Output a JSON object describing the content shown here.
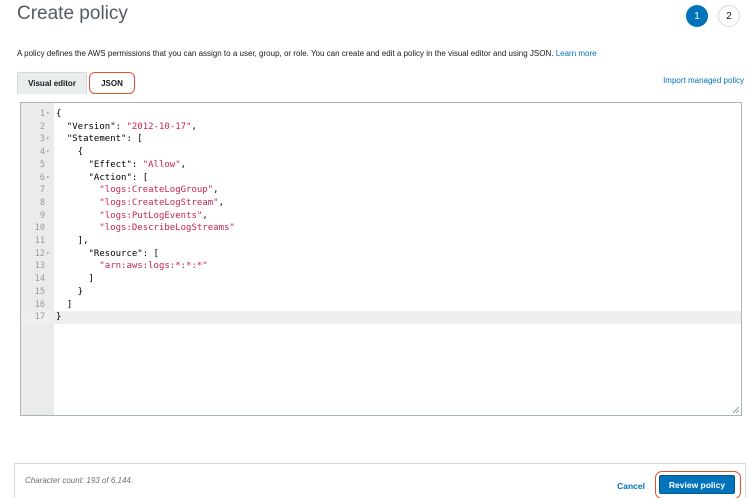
{
  "header": {
    "title": "Create policy",
    "steps": [
      {
        "label": "1",
        "active": true
      },
      {
        "label": "2",
        "active": false
      }
    ]
  },
  "description": {
    "text": "A policy defines the AWS permissions that you can assign to a user, group, or role. You can create and edit a policy in the visual editor and using JSON.",
    "learn_more": "Learn more"
  },
  "tabs": [
    {
      "label": "Visual editor",
      "selected": false
    },
    {
      "label": "JSON",
      "selected": true
    }
  ],
  "import_link": "Import managed policy",
  "editor": {
    "lines": [
      {
        "n": "1",
        "fold": true,
        "text": "{"
      },
      {
        "n": "2",
        "fold": false,
        "text": "  \"Version\": \"2012-10-17\","
      },
      {
        "n": "3",
        "fold": true,
        "text": "  \"Statement\": ["
      },
      {
        "n": "4",
        "fold": true,
        "text": "    {"
      },
      {
        "n": "5",
        "fold": false,
        "text": "      \"Effect\": \"Allow\","
      },
      {
        "n": "6",
        "fold": true,
        "text": "      \"Action\": ["
      },
      {
        "n": "7",
        "fold": false,
        "text": "        \"logs:CreateLogGroup\","
      },
      {
        "n": "8",
        "fold": false,
        "text": "        \"logs:CreateLogStream\","
      },
      {
        "n": "9",
        "fold": false,
        "text": "        \"logs:PutLogEvents\","
      },
      {
        "n": "10",
        "fold": false,
        "text": "        \"logs:DescribeLogStreams\""
      },
      {
        "n": "11",
        "fold": false,
        "text": "    ],"
      },
      {
        "n": "12",
        "fold": true,
        "text": "      \"Resource\": ["
      },
      {
        "n": "13",
        "fold": false,
        "text": "        \"arn:aws:logs:*:*:*\""
      },
      {
        "n": "14",
        "fold": false,
        "text": "      ]"
      },
      {
        "n": "15",
        "fold": false,
        "text": "    }"
      },
      {
        "n": "16",
        "fold": false,
        "text": "  ]"
      },
      {
        "n": "17",
        "fold": false,
        "text": "}"
      }
    ],
    "active_line": "17"
  },
  "footer": {
    "char_count": "Character count: 193 of 6,144.",
    "cancel_label": "Cancel",
    "review_label": "Review policy"
  },
  "colors": {
    "accent": "#0073bb",
    "highlight": "#e0502d",
    "string": "#c7254e"
  }
}
